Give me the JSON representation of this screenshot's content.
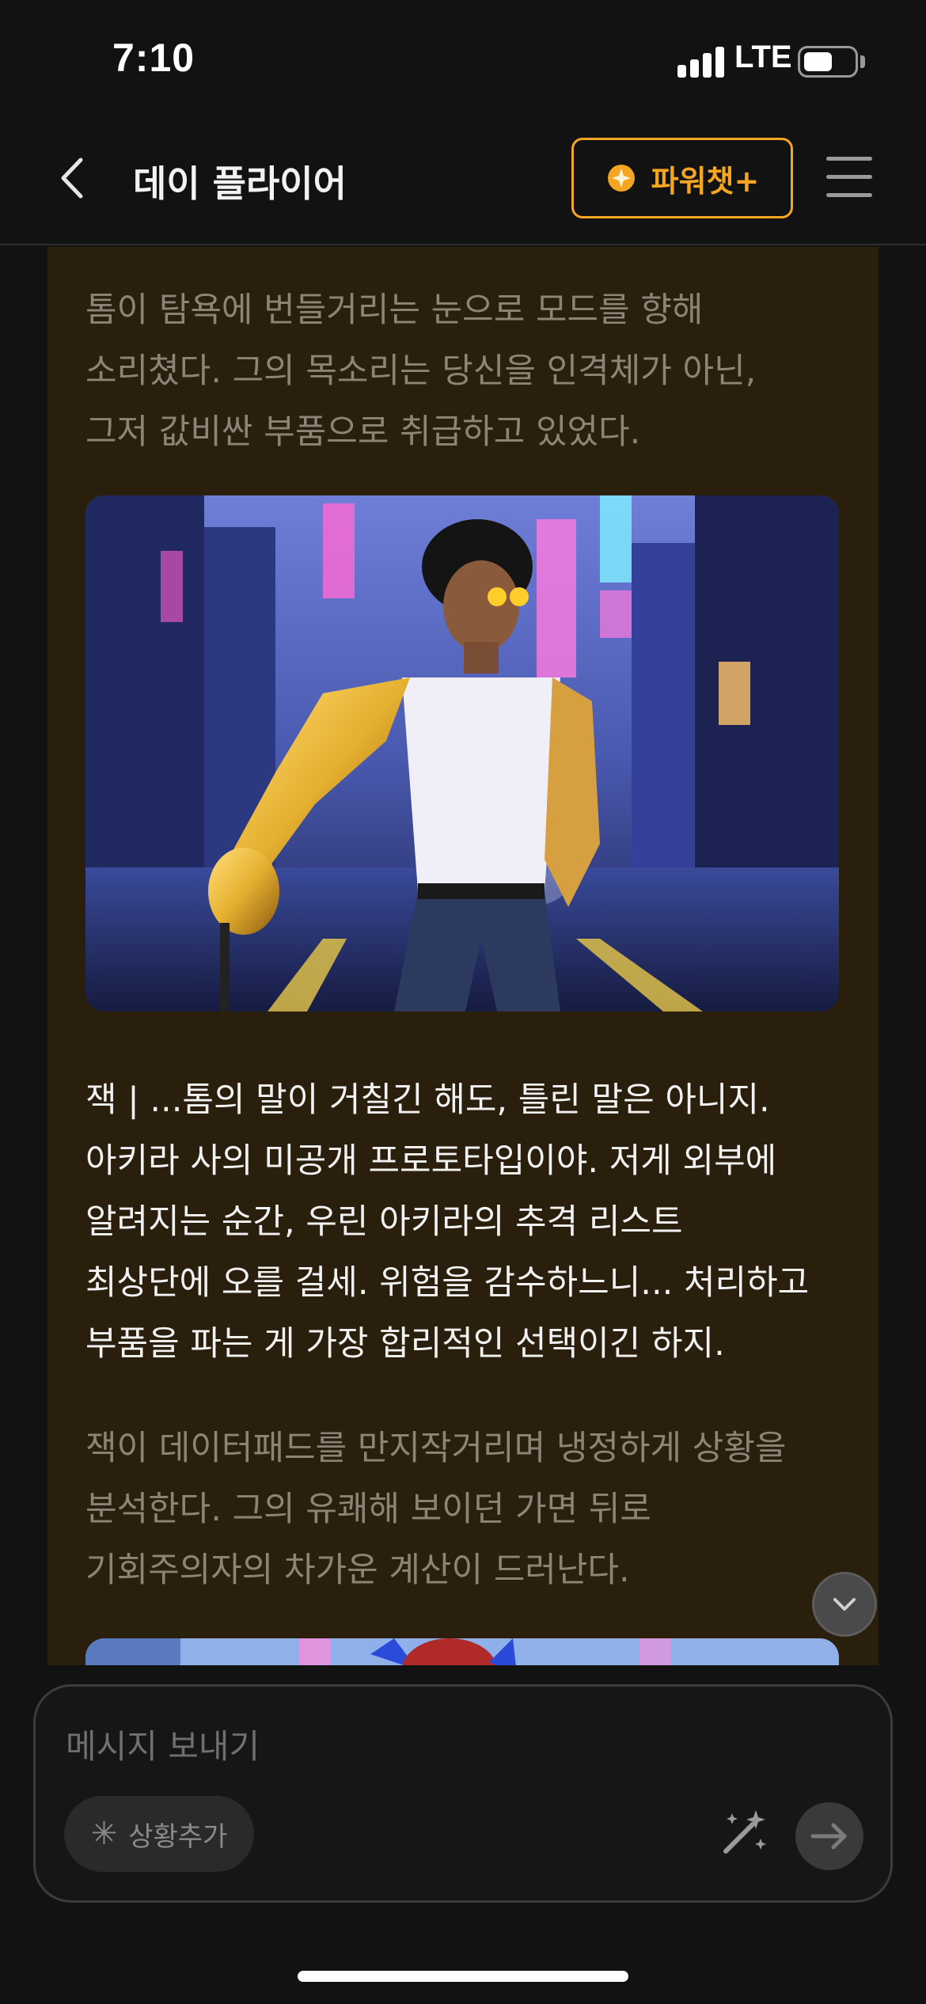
{
  "status_bar": {
    "time": "7:10",
    "network": "LTE",
    "battery_level": 0.55
  },
  "header": {
    "title": "데이 플라이어",
    "power_chat_label": "파워챗+"
  },
  "messages": {
    "narration_1": [
      "톰이 탐욕에 번들거리는 눈으로 모드를 향해",
      "소리쳤다. 그의 목소리는 당신을 인격체가 아닌,",
      "그저 값비싼 부품으로 취급하고 있었다."
    ],
    "dialogue": [
      "잭 | ...톰의 말이 거칠긴 해도, 틀린 말은 아니지.",
      "아키라 사의 미공개 프로토타입이야. 저게 외부에",
      "알려지는 순간, 우린 아키라의 추격 리스트",
      "최상단에 오를 걸세. 위험을 감수하느니... 처리하고",
      "부품을 파는 게 가장 합리적인 선택이긴 하지."
    ],
    "narration_2": [
      "잭이 데이터패드를 만지작거리며 냉정하게 상황을",
      "분석한다. 그의 유쾌해 보이던 가면 뒤로",
      "기회주의자의 차가운 계산이 드러난다."
    ]
  },
  "composer": {
    "placeholder": "메시지 보내기",
    "situation_label": "상황추가",
    "situation_icon": "asterisk-icon"
  },
  "colors": {
    "accent": "#f4a623",
    "chat_bg": "#2a1e0d",
    "narration": "#8d8477",
    "dialogue": "#f2f2f2"
  }
}
